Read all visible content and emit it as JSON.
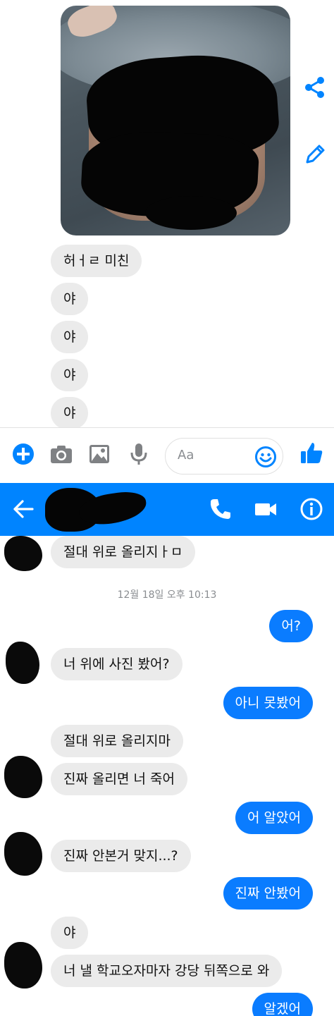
{
  "upper_conversation": {
    "messages_in": [
      "허ㅓㄹ 미친",
      "야",
      "야",
      "야",
      "야"
    ]
  },
  "composer": {
    "placeholder": "Aa"
  },
  "header": {
    "icons": [
      "back-arrow-icon",
      "phone-icon",
      "video-camera-icon",
      "info-icon"
    ],
    "accent_color": "#0084ff"
  },
  "lower_conversation": {
    "top_message": "절대 위로 올리지ㅏㅁ",
    "timestamp": "12월 18일 오후 10:13",
    "messages": [
      {
        "side": "out",
        "text": "어?"
      },
      {
        "side": "in",
        "text": "너 위에 사진 봤어?"
      },
      {
        "side": "out",
        "text": "아니 못봤어"
      },
      {
        "side": "in",
        "text": "절대 위로 올리지마"
      },
      {
        "side": "in",
        "text": "진짜 올리면 너 죽어"
      },
      {
        "side": "out",
        "text": "어 알았어"
      },
      {
        "side": "in",
        "text": "진짜 안본거 맞지...?"
      },
      {
        "side": "out",
        "text": "진짜 안봤어"
      },
      {
        "side": "in",
        "text": "야"
      },
      {
        "side": "in",
        "text": "너 낼 학교오자마자 강당 뒤쪽으로 와"
      },
      {
        "side": "out",
        "text": "알겠어"
      }
    ]
  },
  "colors": {
    "outgoing_bubble": "#0a7cff",
    "incoming_bubble": "#ebebeb",
    "icon_blue": "#0084ff",
    "icon_gray": "#7f8184"
  }
}
